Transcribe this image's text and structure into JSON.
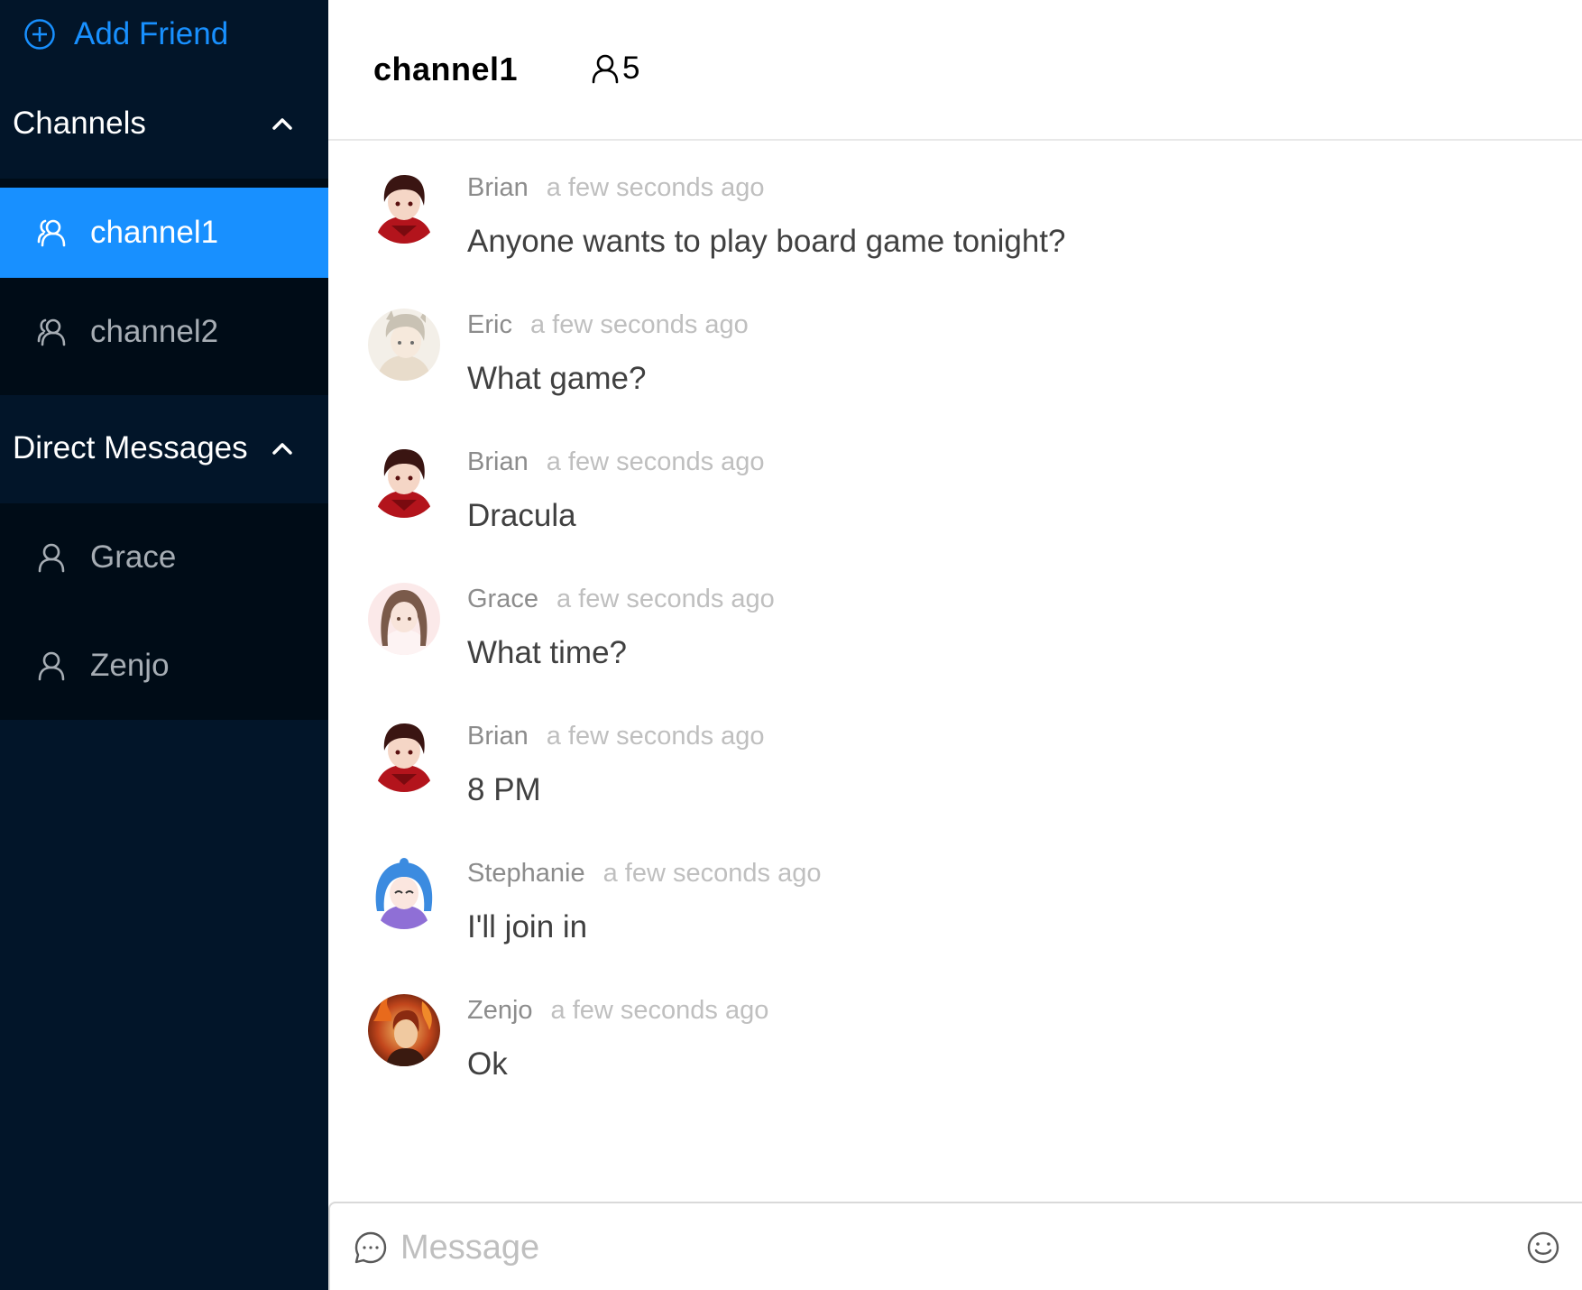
{
  "sidebar": {
    "add_friend_label": "Add Friend",
    "channels_header": "Channels",
    "dm_header": "Direct Messages",
    "channels": [
      {
        "label": "channel1",
        "icon": "team-icon",
        "selected": true
      },
      {
        "label": "channel2",
        "icon": "team-icon",
        "selected": false
      }
    ],
    "direct_messages": [
      {
        "label": "Grace",
        "icon": "user-icon"
      },
      {
        "label": "Zenjo",
        "icon": "user-icon"
      }
    ]
  },
  "header": {
    "channel_name": "channel1",
    "member_count": "5",
    "member_icon": "user-icon"
  },
  "messages": [
    {
      "author": "Brian",
      "time": "a few seconds ago",
      "text": "Anyone wants to play board game tonight?",
      "avatar": "brian-avatar"
    },
    {
      "author": "Eric",
      "time": "a few seconds ago",
      "text": "What game?",
      "avatar": "eric-avatar"
    },
    {
      "author": "Brian",
      "time": "a few seconds ago",
      "text": "Dracula",
      "avatar": "brian-avatar"
    },
    {
      "author": "Grace",
      "time": "a few seconds ago",
      "text": "What time?",
      "avatar": "grace-avatar"
    },
    {
      "author": "Brian",
      "time": "a few seconds ago",
      "text": "8 PM",
      "avatar": "brian-avatar"
    },
    {
      "author": "Stephanie",
      "time": "a few seconds ago",
      "text": "I'll join in",
      "avatar": "stephanie-avatar"
    },
    {
      "author": "Zenjo",
      "time": "a few seconds ago",
      "text": "Ok",
      "avatar": "zenjo-avatar"
    }
  ],
  "composer": {
    "placeholder": "Message",
    "value": "",
    "left_icon": "message-icon",
    "right_icon": "smile-icon"
  },
  "colors": {
    "sidebar_bg": "#021529",
    "submenu_bg": "#000c17",
    "accent": "#1890ff",
    "header_border": "#e8e8e8"
  }
}
